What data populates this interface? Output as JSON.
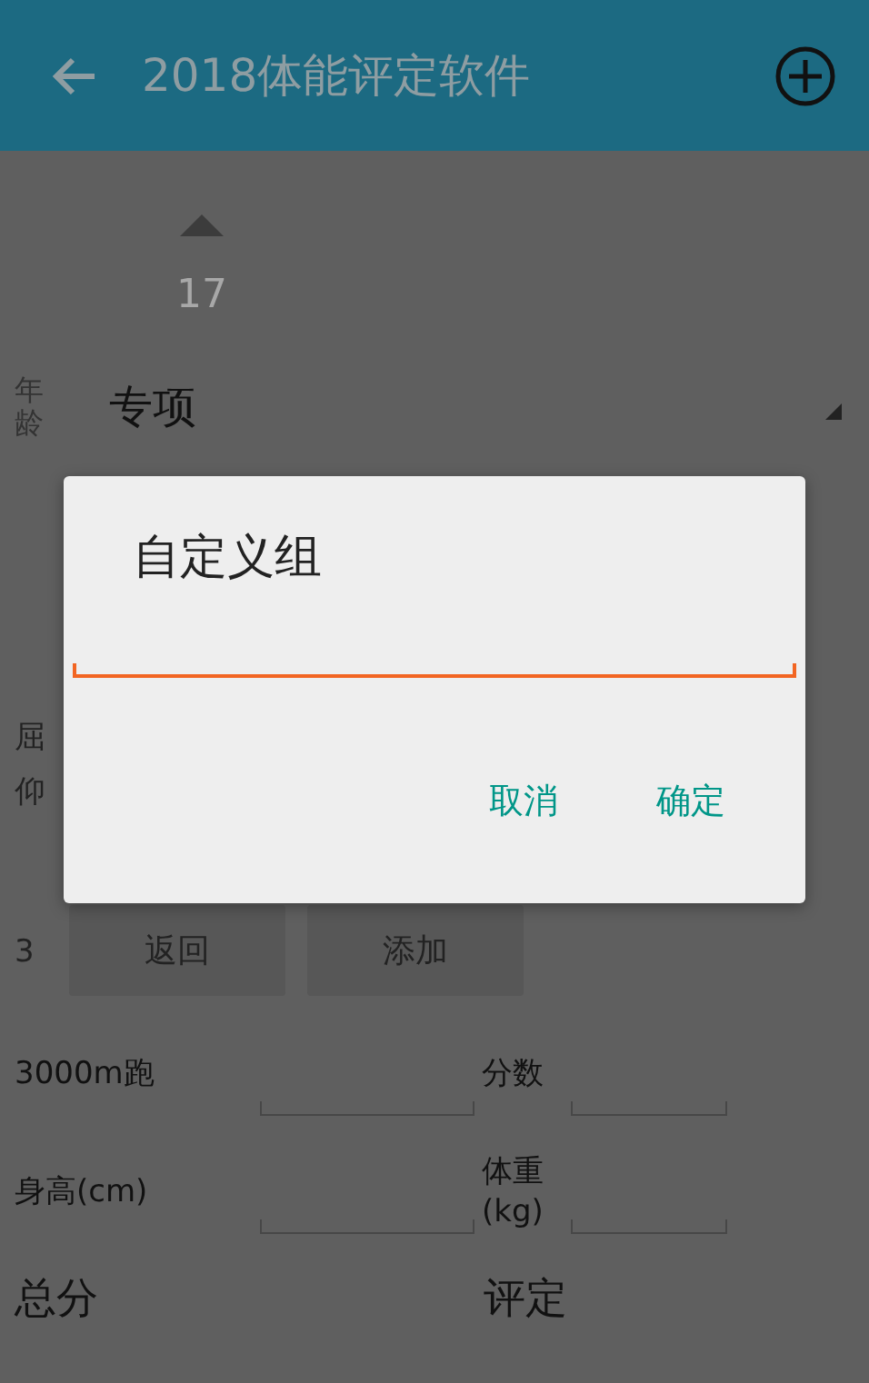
{
  "app_bar": {
    "title": "2018体能评定软件"
  },
  "age_picker": {
    "label": "年龄",
    "value": "17"
  },
  "category_spinner": {
    "value": "专项"
  },
  "partial_rows": [
    {
      "label": "屈"
    },
    {
      "label": "仰"
    },
    {
      "label": "3"
    }
  ],
  "buttons": [
    {
      "label": "返回"
    },
    {
      "label": "添加"
    }
  ],
  "score_rows": [
    {
      "label": "3000m跑",
      "value_label": "分数"
    },
    {
      "label": "身高(cm)",
      "value_label": "体重(kg)"
    }
  ],
  "summary": [
    {
      "label": "总分"
    },
    {
      "label": "评定"
    }
  ],
  "dialog": {
    "title": "自定义组",
    "input": {
      "focused": true
    },
    "buttons": [
      {
        "label": "取消"
      },
      {
        "label": "确定"
      }
    ]
  }
}
